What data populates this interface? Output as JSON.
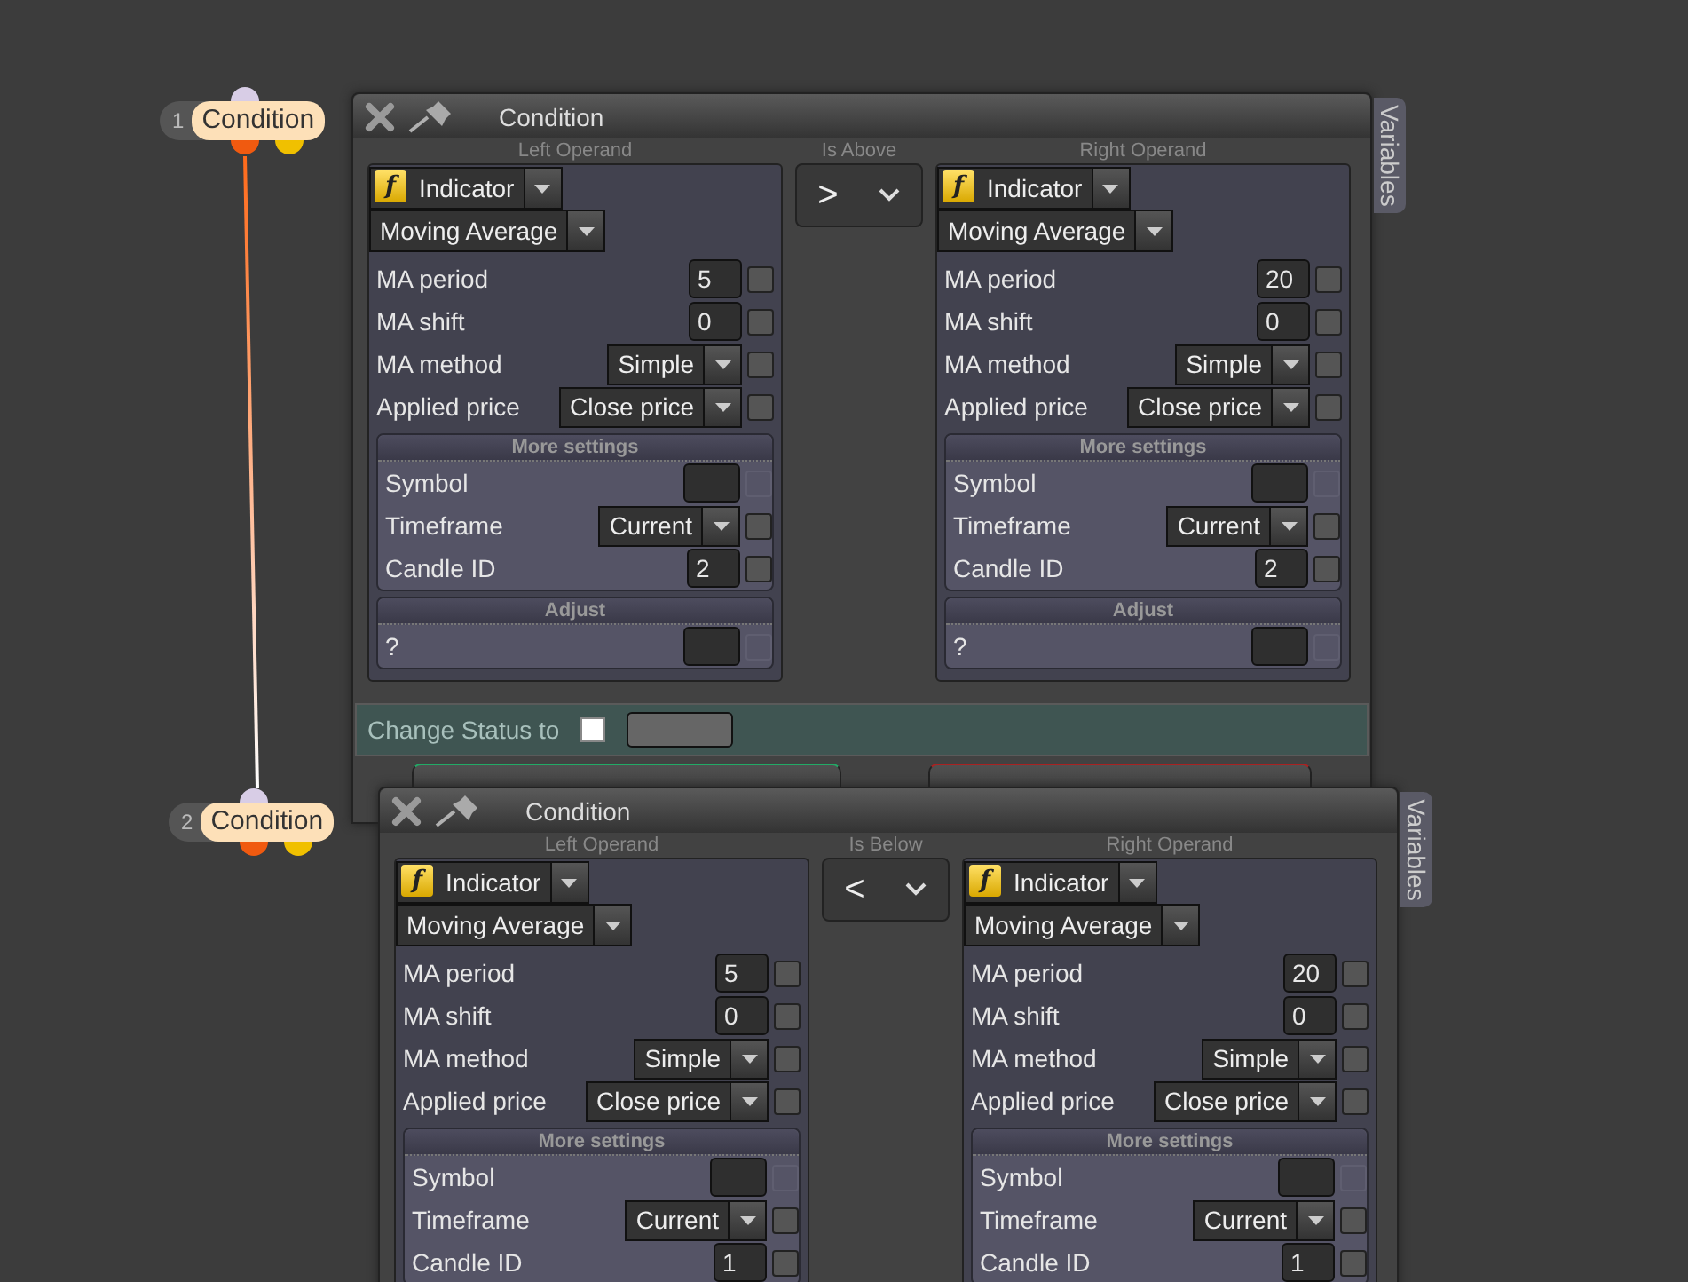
{
  "nodes": [
    {
      "number": "1",
      "label": "Condition"
    },
    {
      "number": "2",
      "label": "Condition"
    }
  ],
  "windows": [
    {
      "title": "Condition",
      "side_tab": "Variables",
      "operator": {
        "label": "Is Above",
        "symbol": ">"
      },
      "operands": [
        {
          "heading": "Left Operand",
          "source_icon": "f",
          "source": "Indicator",
          "indicator": "Moving Average",
          "sections": [
            {
              "kind": "plain",
              "params": [
                {
                  "kind": "number",
                  "label": "MA period",
                  "value": "5",
                  "checked": false,
                  "disabled": false
                },
                {
                  "kind": "number",
                  "label": "MA shift",
                  "value": "0",
                  "checked": false,
                  "disabled": false
                },
                {
                  "kind": "select",
                  "label": "MA method",
                  "value": "Simple",
                  "checked": false,
                  "disabled": false
                },
                {
                  "kind": "select",
                  "label": "Applied price",
                  "value": "Close price",
                  "checked": false,
                  "disabled": false
                }
              ]
            },
            {
              "kind": "group",
              "title": "More settings",
              "params": [
                {
                  "kind": "empty",
                  "label": "Symbol",
                  "checked": false,
                  "disabled": true
                },
                {
                  "kind": "select",
                  "label": "Timeframe",
                  "value": "Current",
                  "checked": false,
                  "disabled": false
                },
                {
                  "kind": "number",
                  "label": "Candle ID",
                  "value": "2",
                  "checked": false,
                  "disabled": false
                }
              ]
            },
            {
              "kind": "group",
              "title": "Adjust",
              "params": [
                {
                  "kind": "empty",
                  "label": "?",
                  "checked": false,
                  "disabled": true
                }
              ]
            }
          ]
        },
        {
          "heading": "Right Operand",
          "source_icon": "f",
          "source": "Indicator",
          "indicator": "Moving Average",
          "sections": [
            {
              "kind": "plain",
              "params": [
                {
                  "kind": "number",
                  "label": "MA period",
                  "value": "20",
                  "checked": false,
                  "disabled": false
                },
                {
                  "kind": "number",
                  "label": "MA shift",
                  "value": "0",
                  "checked": false,
                  "disabled": false
                },
                {
                  "kind": "select",
                  "label": "MA method",
                  "value": "Simple",
                  "checked": false,
                  "disabled": false
                },
                {
                  "kind": "select",
                  "label": "Applied price",
                  "value": "Close price",
                  "checked": false,
                  "disabled": false
                }
              ]
            },
            {
              "kind": "group",
              "title": "More settings",
              "params": [
                {
                  "kind": "empty",
                  "label": "Symbol",
                  "checked": false,
                  "disabled": true
                },
                {
                  "kind": "select",
                  "label": "Timeframe",
                  "value": "Current",
                  "checked": false,
                  "disabled": false
                },
                {
                  "kind": "number",
                  "label": "Candle ID",
                  "value": "2",
                  "checked": false,
                  "disabled": false
                }
              ]
            },
            {
              "kind": "group",
              "title": "Adjust",
              "params": [
                {
                  "kind": "empty",
                  "label": "?",
                  "checked": false,
                  "disabled": true
                }
              ]
            }
          ]
        }
      ],
      "change_status": {
        "label": "Change Status to",
        "checked": false
      },
      "actions": [
        {
          "kind": "update"
        },
        {
          "kind": "delete"
        }
      ]
    },
    {
      "title": "Condition",
      "side_tab": "Variables",
      "operator": {
        "label": "Is Below",
        "symbol": "<"
      },
      "operands": [
        {
          "heading": "Left Operand",
          "source_icon": "f",
          "source": "Indicator",
          "indicator": "Moving Average",
          "sections": [
            {
              "kind": "plain",
              "params": [
                {
                  "kind": "number",
                  "label": "MA period",
                  "value": "5",
                  "checked": false,
                  "disabled": false
                },
                {
                  "kind": "number",
                  "label": "MA shift",
                  "value": "0",
                  "checked": false,
                  "disabled": false
                },
                {
                  "kind": "select",
                  "label": "MA method",
                  "value": "Simple",
                  "checked": false,
                  "disabled": false
                },
                {
                  "kind": "select",
                  "label": "Applied price",
                  "value": "Close price",
                  "checked": false,
                  "disabled": false
                }
              ]
            },
            {
              "kind": "group",
              "title": "More settings",
              "params": [
                {
                  "kind": "empty",
                  "label": "Symbol",
                  "checked": false,
                  "disabled": true
                },
                {
                  "kind": "select",
                  "label": "Timeframe",
                  "value": "Current",
                  "checked": false,
                  "disabled": false
                },
                {
                  "kind": "number",
                  "label": "Candle ID",
                  "value": "1",
                  "checked": false,
                  "disabled": false
                }
              ]
            }
          ]
        },
        {
          "heading": "Right Operand",
          "source_icon": "f",
          "source": "Indicator",
          "indicator": "Moving Average",
          "sections": [
            {
              "kind": "plain",
              "params": [
                {
                  "kind": "number",
                  "label": "MA period",
                  "value": "20",
                  "checked": false,
                  "disabled": false
                },
                {
                  "kind": "number",
                  "label": "MA shift",
                  "value": "0",
                  "checked": false,
                  "disabled": false
                },
                {
                  "kind": "select",
                  "label": "MA method",
                  "value": "Simple",
                  "checked": false,
                  "disabled": false
                },
                {
                  "kind": "select",
                  "label": "Applied price",
                  "value": "Close price",
                  "checked": false,
                  "disabled": false
                }
              ]
            },
            {
              "kind": "group",
              "title": "More settings",
              "params": [
                {
                  "kind": "empty",
                  "label": "Symbol",
                  "checked": false,
                  "disabled": true
                },
                {
                  "kind": "select",
                  "label": "Timeframe",
                  "value": "Current",
                  "checked": false,
                  "disabled": false
                },
                {
                  "kind": "number",
                  "label": "Candle ID",
                  "value": "1",
                  "checked": false,
                  "disabled": false
                }
              ]
            }
          ]
        }
      ]
    }
  ]
}
